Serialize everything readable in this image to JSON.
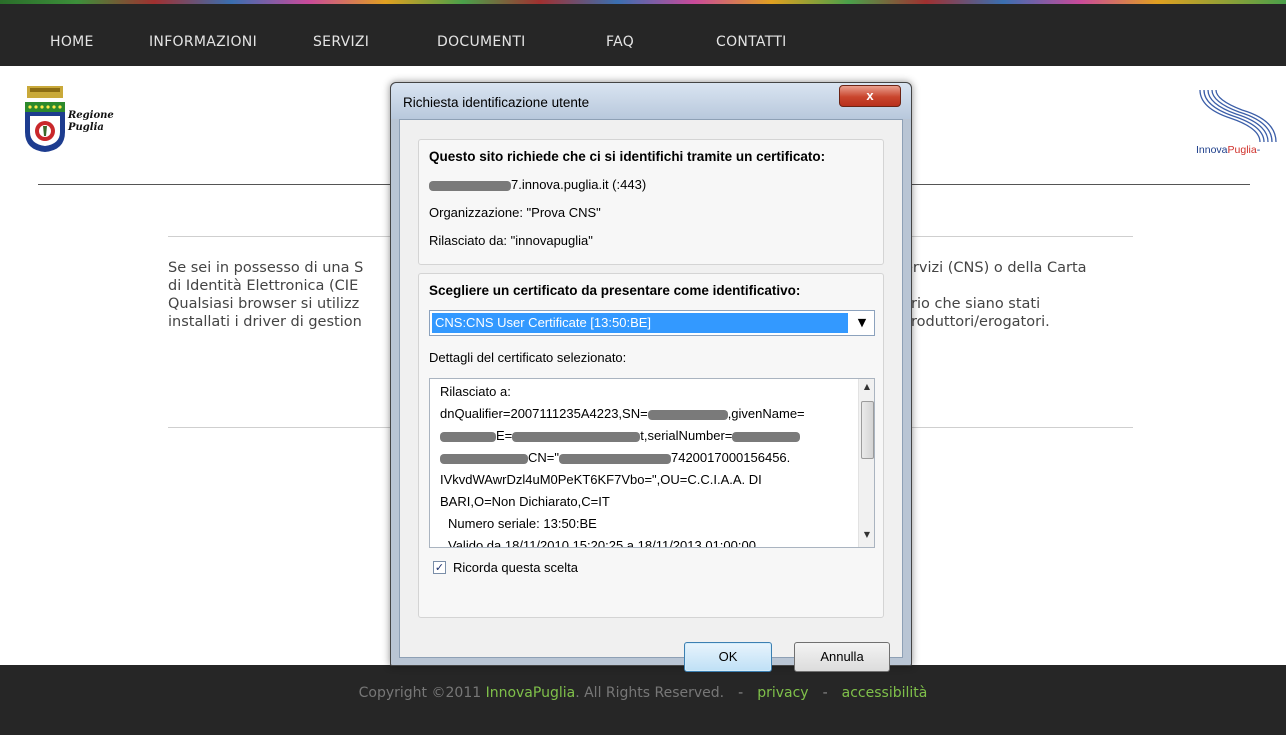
{
  "nav": {
    "items": [
      "HOME",
      "INFORMAZIONI",
      "SERVIZI",
      "DOCUMENTI",
      "FAQ",
      "CONTATTI"
    ]
  },
  "header": {
    "left_logo_text_line1": "Regione",
    "left_logo_text_line2": "Puglia",
    "right_logo_text_part1": "Innova",
    "right_logo_text_part2": "Puglia",
    "right_logo_suffix": "-"
  },
  "content": {
    "line1_left": "Se sei in possesso di una S",
    "line1_right": "ervizi (CNS) o della Carta",
    "line2_left": "di Identità Elettronica (CIE",
    "line3_left": "Qualsiasi browser si utilizz",
    "line3_right": "rio che siano stati",
    "line4_left": "installati i driver di gestion",
    "line4_right": "roduttori/erogatori."
  },
  "footer": {
    "copyright_prefix": "Copyright ©2011 ",
    "brand": "InnovaPuglia",
    "copyright_suffix": ". All Rights Reserved.",
    "separator": "-",
    "privacy": "privacy",
    "accessibility": "accessibilità"
  },
  "dialog": {
    "title": "Richiesta identificazione utente",
    "close_label": "x",
    "request_heading": "Questo sito richiede che ci si identifichi tramite un certificato:",
    "host_suffix": "7.innova.puglia.it (:443)",
    "organization": "Organizzazione: \"Prova CNS\"",
    "issued_by": "Rilasciato da: \"innovapuglia\"",
    "choose_heading": "Scegliere un certificato da presentare come identificativo:",
    "selected_certificate": "CNS:CNS User Certificate [13:50:BE]",
    "details_label": "Dettagli del certificato selezionato:",
    "details_lines": [
      "Rilasciato a:",
      "dnQualifier=2007111235A4223,SN=",
      ",givenName=",
      "E=",
      "t,serialNumber=",
      "CN=\"",
      "7420017000156456.",
      "IVkvdWAwrDzl4uM0PeKT6KF7Vbo=\",OU=C.C.I.A.A. DI",
      "BARI,O=Non Dichiarato,C=IT",
      "Numero seriale: 13:50:BE",
      "Valido da 18/11/2010 15:20:25 a 18/11/2013 01:00:00"
    ],
    "remember_label": "Ricorda questa scelta",
    "remember_checked": true,
    "ok_label": "OK",
    "cancel_label": "Annulla"
  }
}
